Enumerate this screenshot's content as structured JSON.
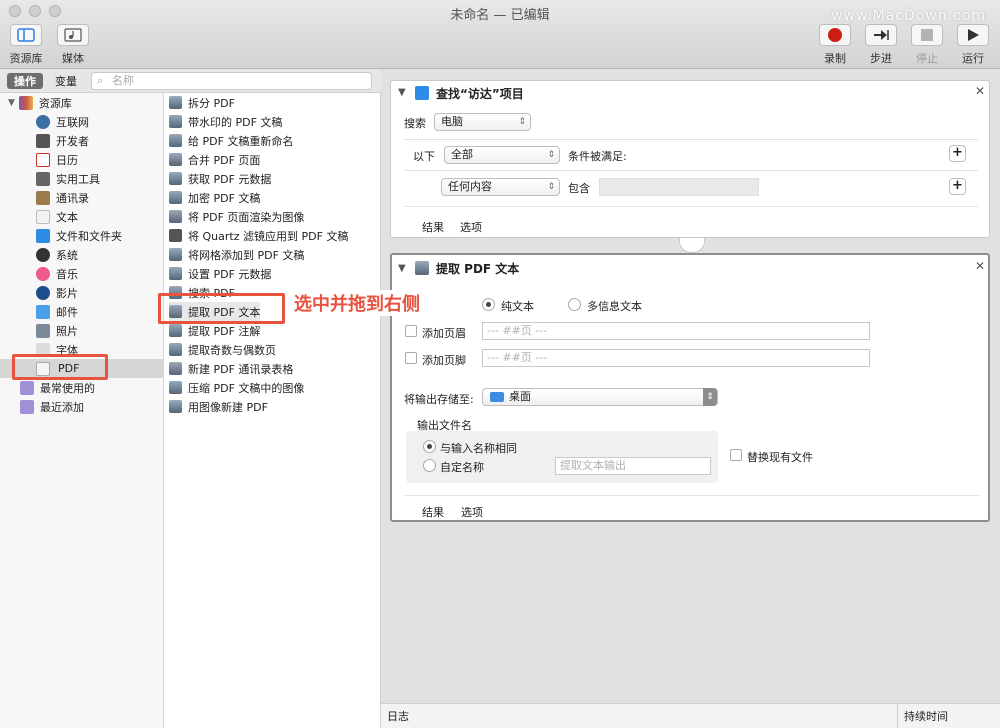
{
  "window": {
    "title": "未命名 — 已编辑",
    "watermark": "www.MacDown.com"
  },
  "toolbar": {
    "library_label": "资源库",
    "media_label": "媒体",
    "record_label": "录制",
    "step_label": "步进",
    "stop_label": "停止",
    "run_label": "运行"
  },
  "left_header": {
    "tab_actions": "操作",
    "tab_variables": "变量",
    "search_placeholder": "名称"
  },
  "library": {
    "root": "资源库",
    "items": [
      "互联网",
      "开发者",
      "日历",
      "实用工具",
      "通讯录",
      "文本",
      "文件和文件夹",
      "系统",
      "音乐",
      "影片",
      "邮件",
      "照片",
      "字体",
      "PDF"
    ],
    "recent_used": "最常使用的",
    "recent_added": "最近添加",
    "selected": "PDF"
  },
  "actions": {
    "items": [
      "拆分 PDF",
      "带水印的 PDF 文稿",
      "给 PDF 文稿重新命名",
      "合并 PDF 页面",
      "获取 PDF 元数据",
      "加密 PDF 文稿",
      "将 PDF 页面渲染为图像",
      "将 Quartz 滤镜应用到 PDF 文稿",
      "将网格添加到 PDF 文稿",
      "设置 PDF 元数据",
      "搜索 PDF",
      "提取 PDF 文本",
      "提取 PDF 注解",
      "提取奇数与偶数页",
      "新建 PDF 通讯录表格",
      "压缩 PDF 文稿中的图像",
      "用图像新建 PDF"
    ],
    "selected_index": 11
  },
  "card1": {
    "title": "查找“访达”项目",
    "search_label": "搜索",
    "search_value": "电脑",
    "below_label": "以下",
    "all_value": "全部",
    "condition_label": "条件被满足:",
    "any_content": "任何内容",
    "contains_label": "包含",
    "results_tab": "结果",
    "options_tab": "选项"
  },
  "card2": {
    "title": "提取 PDF 文本",
    "plain_text": "纯文本",
    "rich_text": "多信息文本",
    "add_header": "添加页眉",
    "header_value": "--- ##页 ---",
    "add_footer": "添加页脚",
    "footer_value": "--- ##页 ---",
    "save_to_label": "将输出存储至:",
    "save_to_value": "桌面",
    "output_name_label": "输出文件名",
    "same_as_input": "与输入名称相同",
    "custom_name": "自定名称",
    "custom_placeholder": "提取文本输出",
    "replace_existing": "替换现有文件",
    "results_tab": "结果",
    "options_tab": "选项"
  },
  "log": {
    "log_label": "日志",
    "duration_label": "持续时间"
  },
  "annotation": {
    "callout_text": "选中并拖到右侧"
  },
  "colors": {
    "highlight": "#e8533f",
    "record": "#cc1d12",
    "folder": "#3d8be3"
  }
}
